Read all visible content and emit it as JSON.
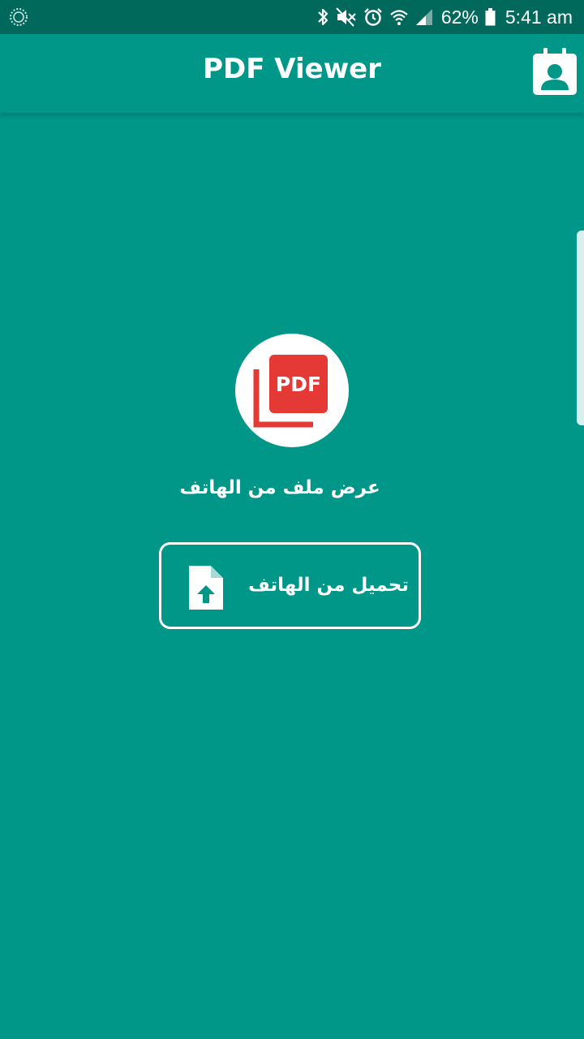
{
  "status_bar": {
    "battery_percent": "62%",
    "time": "5:41 am",
    "icons": [
      "notification-ring-icon",
      "bluetooth-icon",
      "mute-icon",
      "alarm-icon",
      "wifi-icon",
      "signal-icon",
      "battery-icon"
    ]
  },
  "app_bar": {
    "title": "PDF Viewer",
    "action_icon": "contact-card-icon"
  },
  "main": {
    "logo_text": "PDF",
    "caption": "عرض ملف من الهاتف",
    "upload_button": {
      "label": "تحميل من الهاتف",
      "icon": "file-upload-icon"
    }
  },
  "colors": {
    "background": "#009688",
    "status_bar": "#00695c",
    "pdf_red": "#e53935",
    "white": "#ffffff"
  }
}
